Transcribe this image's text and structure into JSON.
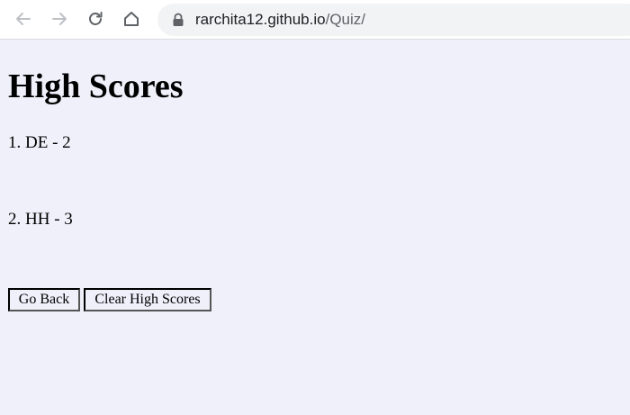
{
  "browser": {
    "url_host": "rarchita12.github.io",
    "url_path": "/Quiz/"
  },
  "page": {
    "title": "High Scores",
    "scores": [
      "1. DE - 2",
      "2. HH - 3"
    ],
    "buttons": {
      "go_back": "Go Back",
      "clear": "Clear High Scores"
    }
  },
  "colors": {
    "page_background": "#f0f0fb",
    "toolbar_background": "#ffffff",
    "omnibox_background": "#f1f3f4"
  }
}
